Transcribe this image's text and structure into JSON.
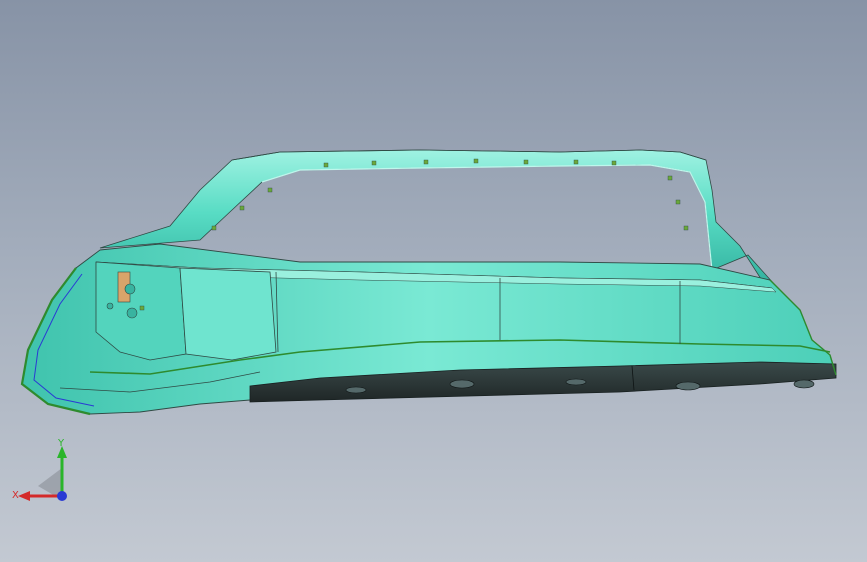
{
  "viewport": {
    "background_top": "#8793a6",
    "background_bottom": "#c3c9d2",
    "model_surface_color": "#5fe0c8",
    "model_shadow_color": "#2a3a3a",
    "model_edge_color": "#2f4a44",
    "curve_color": "#2e8b2e"
  },
  "triad": {
    "x_label": "X",
    "y_label": "Y",
    "x_color": "#d42a2a",
    "y_color": "#2ab52a",
    "z_color": "#2a3ad4"
  }
}
